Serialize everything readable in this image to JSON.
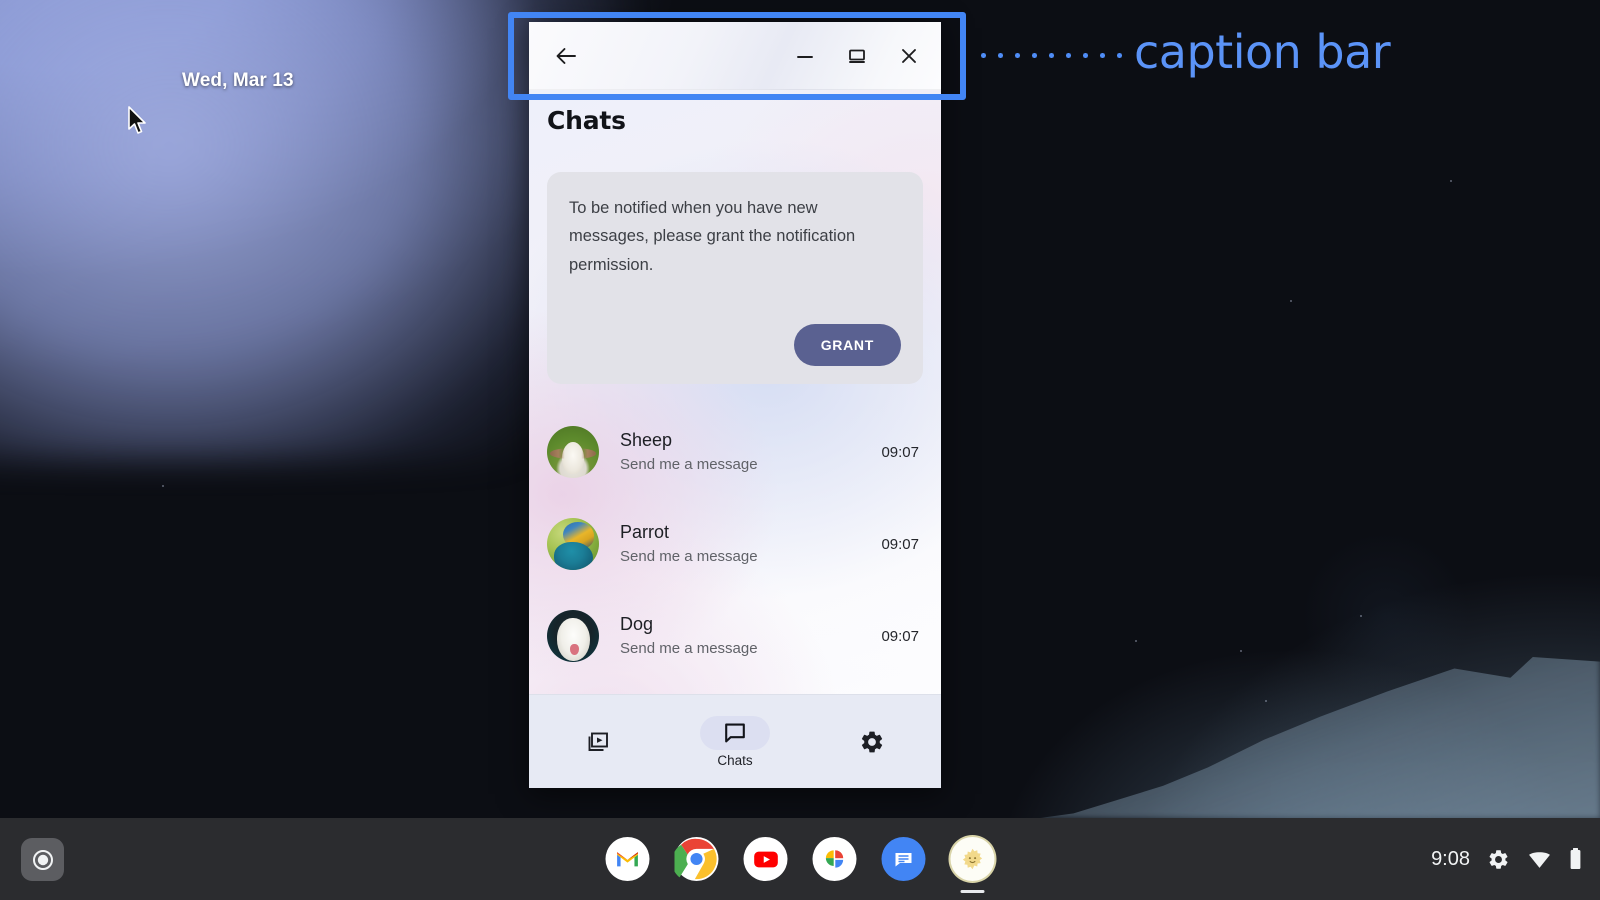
{
  "desktop": {
    "date": "Wed, Mar 13",
    "cursor_icon": "arrow-cursor-icon"
  },
  "annotation": {
    "label": "caption bar",
    "color": "#5b93f7",
    "highlight_color": "#4285f4",
    "leader_icon": "dotted-leader-line"
  },
  "window": {
    "caption_bar": {
      "back_icon": "back-arrow-icon",
      "minimize_icon": "minimize-icon",
      "restore_icon": "restore-window-icon",
      "close_icon": "close-icon"
    },
    "app": {
      "title": "Chats",
      "permission_card": {
        "message": "To be notified when you have new messages, please grant the notification permission.",
        "grant_label": "GRANT",
        "grant_color": "#5a6191"
      },
      "chats": [
        {
          "name": "Sheep",
          "preview": "Send me a message",
          "time": "09:07",
          "avatar_icon": "sheep-avatar"
        },
        {
          "name": "Parrot",
          "preview": "Send me a message",
          "time": "09:07",
          "avatar_icon": "parrot-avatar"
        },
        {
          "name": "Dog",
          "preview": "Send me a message",
          "time": "09:07",
          "avatar_icon": "dog-avatar"
        }
      ],
      "bottom_nav": [
        {
          "label": "",
          "icon": "video-library-icon",
          "active": false
        },
        {
          "label": "Chats",
          "icon": "chat-bubble-icon",
          "active": true
        },
        {
          "label": "",
          "icon": "settings-gear-icon",
          "active": false
        }
      ]
    }
  },
  "shelf": {
    "launcher_icon": "launcher-circle-icon",
    "apps": [
      {
        "name": "Gmail",
        "icon": "gmail-icon",
        "running": false
      },
      {
        "name": "Chrome",
        "icon": "chrome-icon",
        "running": false
      },
      {
        "name": "YouTube",
        "icon": "youtube-icon",
        "running": false
      },
      {
        "name": "Google Photos",
        "icon": "photos-icon",
        "running": false
      },
      {
        "name": "Messages",
        "icon": "messages-icon",
        "running": false
      },
      {
        "name": "Chat App",
        "icon": "sun-app-icon",
        "running": true
      }
    ],
    "tray": {
      "clock": "9:08",
      "settings_icon": "gear-icon",
      "wifi_icon": "wifi-icon",
      "battery_icon": "battery-icon"
    }
  }
}
